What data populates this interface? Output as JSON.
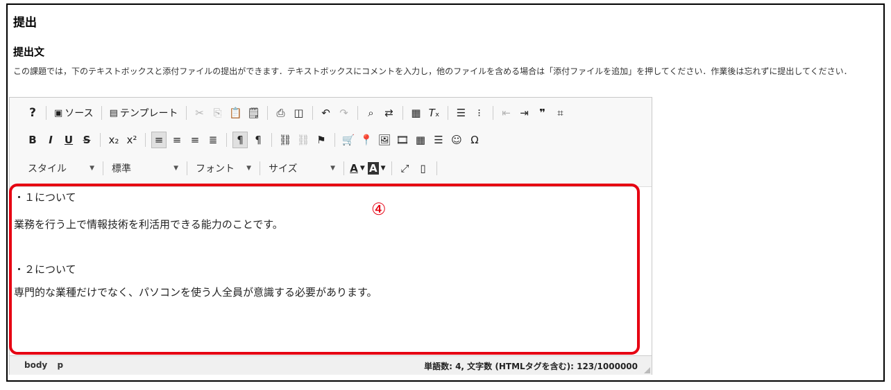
{
  "section_title": "提出",
  "subsection_title": "提出文",
  "description": "この課題では，下のテキストボックスと添付ファイルの提出ができます．テキストボックスにコメントを入力し，他のファイルを含める場合は「添付ファイルを追加」を押してください．作業後は忘れずに提出してください．",
  "toolbar": {
    "help": "?",
    "source": "ソース",
    "template": "テンプレート",
    "bold": "B",
    "italic": "I",
    "underline": "U",
    "strike": "S",
    "omega": "Ω",
    "styles_label": "スタイル",
    "format_label": "標準",
    "font_label": "フォント",
    "size_label": "サイズ",
    "text_color": "A",
    "bg_color": "A"
  },
  "content": {
    "lines": [
      "・１について",
      "業務を行う上で情報技術を利活用できる能力のことです。",
      "・２について",
      "専門的な業種だけでなく、パソコンを使う人全員が意識する必要があります。"
    ]
  },
  "annotation_marker": "④",
  "annotation_color": "#e60012",
  "status": {
    "path": [
      "body",
      "p"
    ],
    "counter": "単語数: 4, 文字数 (HTMLタグを含む): 123/1000000"
  }
}
